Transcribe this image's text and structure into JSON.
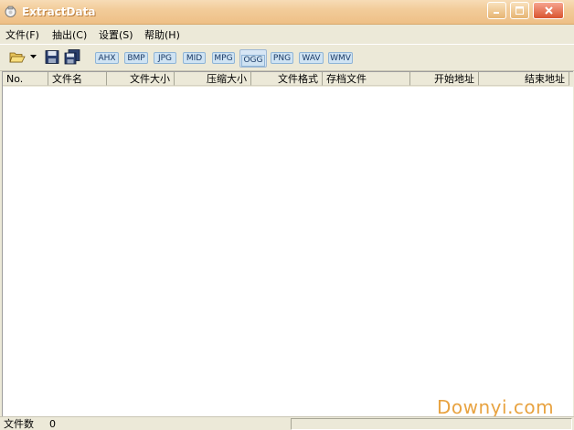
{
  "window": {
    "title": "ExtractData"
  },
  "menu": [
    {
      "label": "文件(F)"
    },
    {
      "label": "抽出(C)"
    },
    {
      "label": "设置(S)"
    },
    {
      "label": "帮助(H)"
    }
  ],
  "toolbar": {
    "open_icon": "folder-open-icon",
    "save_icon": "floppy-save-icon",
    "save_all_icon": "floppy-save-all-icon",
    "formats": [
      "AHX",
      "BMP",
      "JPG",
      "MID",
      "MPG",
      "OGG",
      "PNG",
      "WAV",
      "WMV"
    ],
    "active_format": "OGG"
  },
  "columns": [
    {
      "label": "No."
    },
    {
      "label": "文件名"
    },
    {
      "label": "文件大小"
    },
    {
      "label": "压缩大小"
    },
    {
      "label": "文件格式"
    },
    {
      "label": "存档文件"
    },
    {
      "label": "开始地址"
    },
    {
      "label": "结束地址"
    }
  ],
  "status": {
    "file_count_label": "文件数",
    "file_count_value": "0"
  },
  "watermark": "Downyi.com",
  "colors": {
    "titlebar": "#f2cc9a",
    "format_button": "#cfe3f3",
    "watermark": "#e8a341"
  }
}
